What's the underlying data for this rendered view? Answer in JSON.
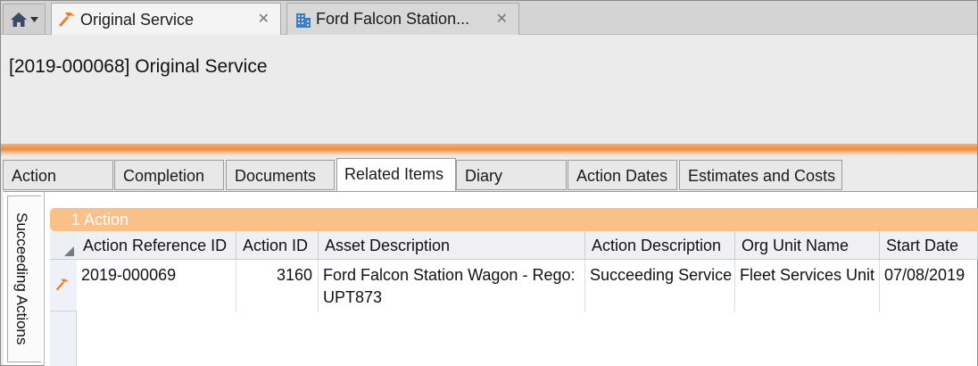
{
  "tabs": [
    {
      "label": "Original Service",
      "icon": "hammer-icon",
      "active": true
    },
    {
      "label": "Ford Falcon Station...",
      "icon": "building-icon",
      "active": false
    }
  ],
  "page": {
    "title": "[2019-000068] Original Service"
  },
  "section_tabs": [
    {
      "label": "Action"
    },
    {
      "label": "Completion"
    },
    {
      "label": "Documents"
    },
    {
      "label": "Related Items",
      "active": true
    },
    {
      "label": "Diary"
    },
    {
      "label": "Action Dates"
    },
    {
      "label": "Estimates and Costs"
    }
  ],
  "side_tab": {
    "label": "Succeeding Actions"
  },
  "grid": {
    "group_label": "1 Action",
    "columns": [
      "Action Reference ID",
      "Action ID",
      "Asset Description",
      "Action Description",
      "Org Unit Name",
      "Start Date"
    ],
    "rows": [
      {
        "action_reference_id": "2019-000069",
        "action_id": "3160",
        "asset_description_line1": "Ford Falcon Station Wagon - Rego:",
        "asset_description_line2": "UPT873",
        "action_description": "Succeeding Service",
        "org_unit_name": "Fleet Services Unit",
        "start_date": "07/08/2019",
        "row_icon": "hammer-icon"
      }
    ]
  },
  "colors": {
    "accent": "#f08a3a",
    "group_band": "#f9c08a",
    "hammer": "#f07b1f",
    "building": "#3b7fc4"
  }
}
